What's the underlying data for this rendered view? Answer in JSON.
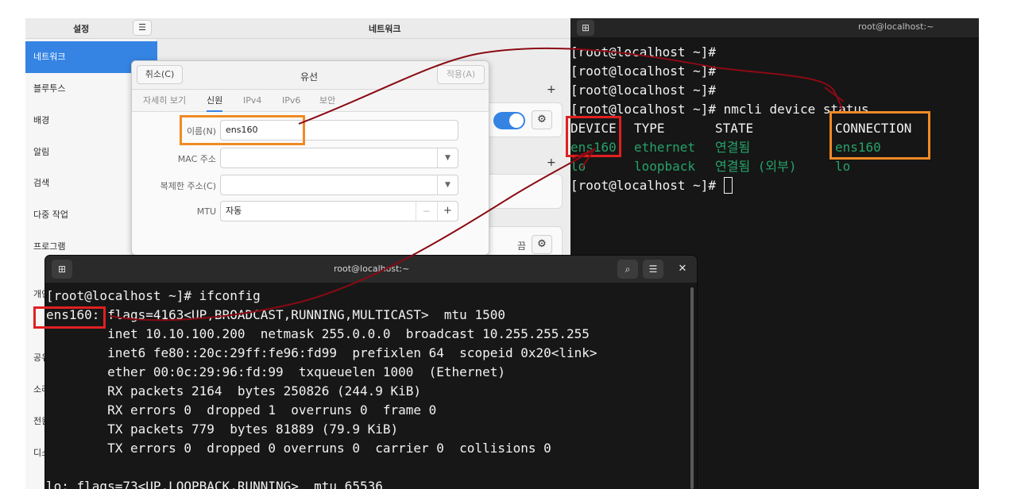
{
  "settings": {
    "sidebar_title": "설정",
    "main_title": "네트워크",
    "menu_icon": "hamburger-menu-icon",
    "sidebar_items": [
      "네트워크",
      "블루투스",
      "배경",
      "알림",
      "검색",
      "다중 작업",
      "프로그램",
      "개인",
      "공유",
      "소리",
      "전원",
      "디스플레이"
    ],
    "card_value_off": "끔"
  },
  "dialog": {
    "cancel": "취소(C)",
    "title": "유선",
    "apply": "적용(A)",
    "tabs": [
      "자세히 보기",
      "신원",
      "IPv4",
      "IPv6",
      "보안"
    ],
    "fields": {
      "name_label": "이름(N)",
      "name_value": "ens160",
      "mac_label": "MAC 주소",
      "clone_label": "복제한 주소(C)",
      "mtu_label": "MTU",
      "mtu_value": "자동"
    }
  },
  "term_right": {
    "title": "root@localhost:~",
    "lines": [
      "[root@localhost ~]#",
      "[root@localhost ~]#",
      "[root@localhost ~]#",
      "[root@localhost ~]# nmcli device status"
    ],
    "header": {
      "device": "DEVICE",
      "type": "TYPE",
      "state": "STATE",
      "connection": "CONNECTION"
    },
    "rows": [
      {
        "device": "ens160",
        "type": "ethernet",
        "state": "연결됨",
        "connection": "ens160"
      },
      {
        "device": "lo",
        "type": "loopback",
        "state": "연결됨 (외부)",
        "connection": "lo"
      }
    ],
    "last_prompt": "[root@localhost ~]# "
  },
  "term_bottom": {
    "title": "root@localhost:~",
    "prompt": "[root@localhost ~]# ifconfig",
    "iface": "ens160:",
    "flags": " flags=4163<UP,BROADCAST,RUNNING,MULTICAST>  mtu 1500",
    "lines": [
      "        inet 10.10.100.200  netmask 255.0.0.0  broadcast 10.255.255.255",
      "        inet6 fe80::20c:29ff:fe96:fd99  prefixlen 64  scopeid 0x20<link>",
      "        ether 00:0c:29:96:fd:99  txqueuelen 1000  (Ethernet)",
      "        RX packets 2164  bytes 250826 (244.9 KiB)",
      "        RX errors 0  dropped 1  overruns 0  frame 0",
      "        TX packets 779  bytes 81889 (79.9 KiB)",
      "        TX errors 0  dropped 0 overruns 0  carrier 0  collisions 0",
      "",
      "lo: flags=73<UP,LOOPBACK,RUNNING>  mtu 65536"
    ]
  },
  "colors": {
    "accent": "#3584e4",
    "terminal_green": "#26a269",
    "annotation_red": "#e02020",
    "annotation_orange": "#f08a24",
    "annotation_line": "#8b0a14"
  }
}
